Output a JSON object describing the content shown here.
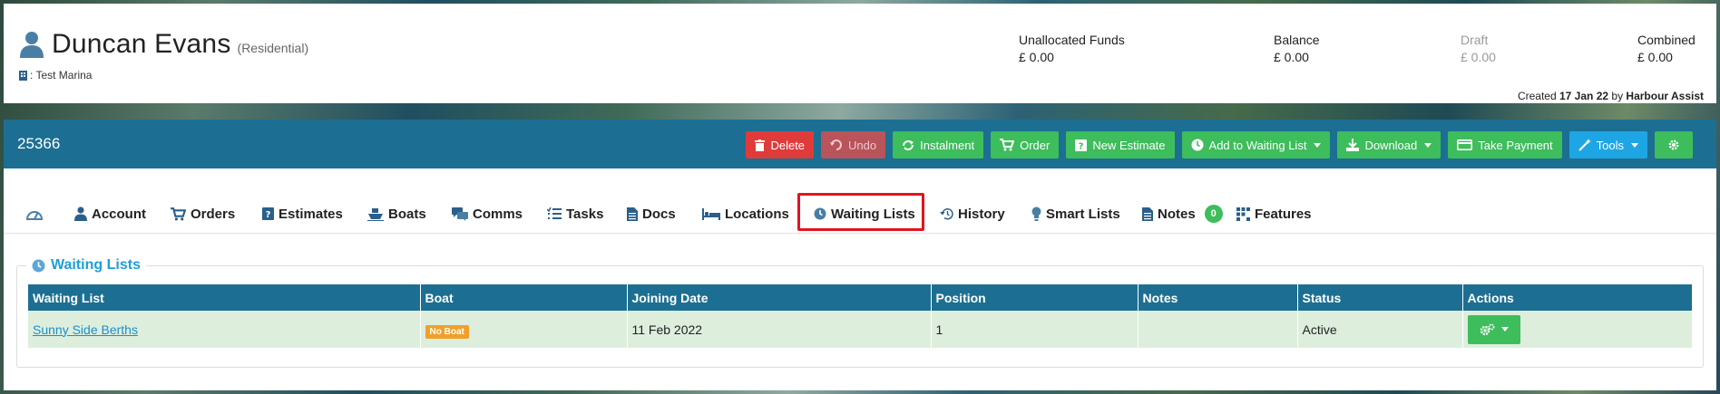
{
  "header": {
    "customer_name": "Duncan Evans",
    "customer_type": "(Residential)",
    "marina": ": Test Marina",
    "funds": [
      {
        "label": "Unallocated Funds",
        "value": "£ 0.00"
      },
      {
        "label": "Balance",
        "value": "£ 0.00"
      },
      {
        "label": "Draft",
        "value": "£ 0.00"
      },
      {
        "label": "Combined",
        "value": "£ 0.00"
      }
    ],
    "created_prefix": "Created",
    "created_date": "17 Jan 22",
    "created_by_prefix": "by",
    "created_by": "Harbour Assist"
  },
  "toolbar": {
    "account_number": "25366",
    "delete": "Delete",
    "undo": "Undo",
    "instalment": "Instalment",
    "order": "Order",
    "new_estimate": "New Estimate",
    "add_to_waiting_list": "Add to Waiting List",
    "download": "Download",
    "take_payment": "Take Payment",
    "tools": "Tools"
  },
  "tabs": {
    "account": "Account",
    "orders": "Orders",
    "estimates": "Estimates",
    "boats": "Boats",
    "comms": "Comms",
    "tasks": "Tasks",
    "docs": "Docs",
    "locations": "Locations",
    "waiting_lists": "Waiting Lists",
    "history": "History",
    "smart_lists": "Smart Lists",
    "notes": "Notes",
    "notes_count": "0",
    "features": "Features"
  },
  "panel": {
    "title": "Waiting Lists",
    "columns": [
      "Waiting List",
      "Boat",
      "Joining Date",
      "Position",
      "Notes",
      "Status",
      "Actions"
    ],
    "row": {
      "waiting_list": "Sunny Side Berths",
      "boat": "No Boat",
      "joining_date": "11 Feb 2022",
      "position": "1",
      "notes": "",
      "status": "Active"
    }
  },
  "colors": {
    "brand_bar": "#1c6f92",
    "button_green": "#3dbd5b",
    "button_red": "#e03b3b",
    "button_blue": "#1ea6e4",
    "row_bg": "#ddeedd",
    "highlight": "#e0141e"
  }
}
